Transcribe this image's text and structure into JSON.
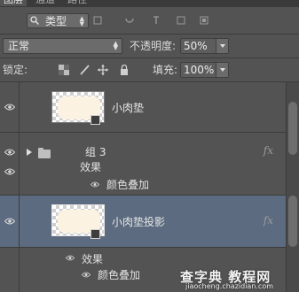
{
  "tabs": [
    "图层",
    "通道",
    "路径"
  ],
  "filter": {
    "kind_label": "类型"
  },
  "blend": {
    "mode": "正常",
    "opacity_label": "不透明度:",
    "opacity_value": "50%"
  },
  "lock": {
    "label": "锁定:",
    "fill_label": "填充:",
    "fill_value": "100%"
  },
  "layers": [
    {
      "name": "小肉垫",
      "type": "pixel",
      "fx": false,
      "selected": false
    },
    {
      "name": "组 3",
      "type": "group",
      "fx": true,
      "effects_label": "效果",
      "effect": "颜色叠加"
    },
    {
      "name": "小肉垫投影",
      "type": "pixel",
      "fx": true,
      "selected": true,
      "effects_label": "效果",
      "effect": "颜色叠加"
    }
  ],
  "fx_symbol": "fx",
  "watermark": {
    "main": "查字典 教程网",
    "sub": "jiaocheng.chazidian.com"
  },
  "colors": {
    "panel": "#535353",
    "selected_row": "#5c6b80",
    "separator": "#3c3c3c"
  }
}
